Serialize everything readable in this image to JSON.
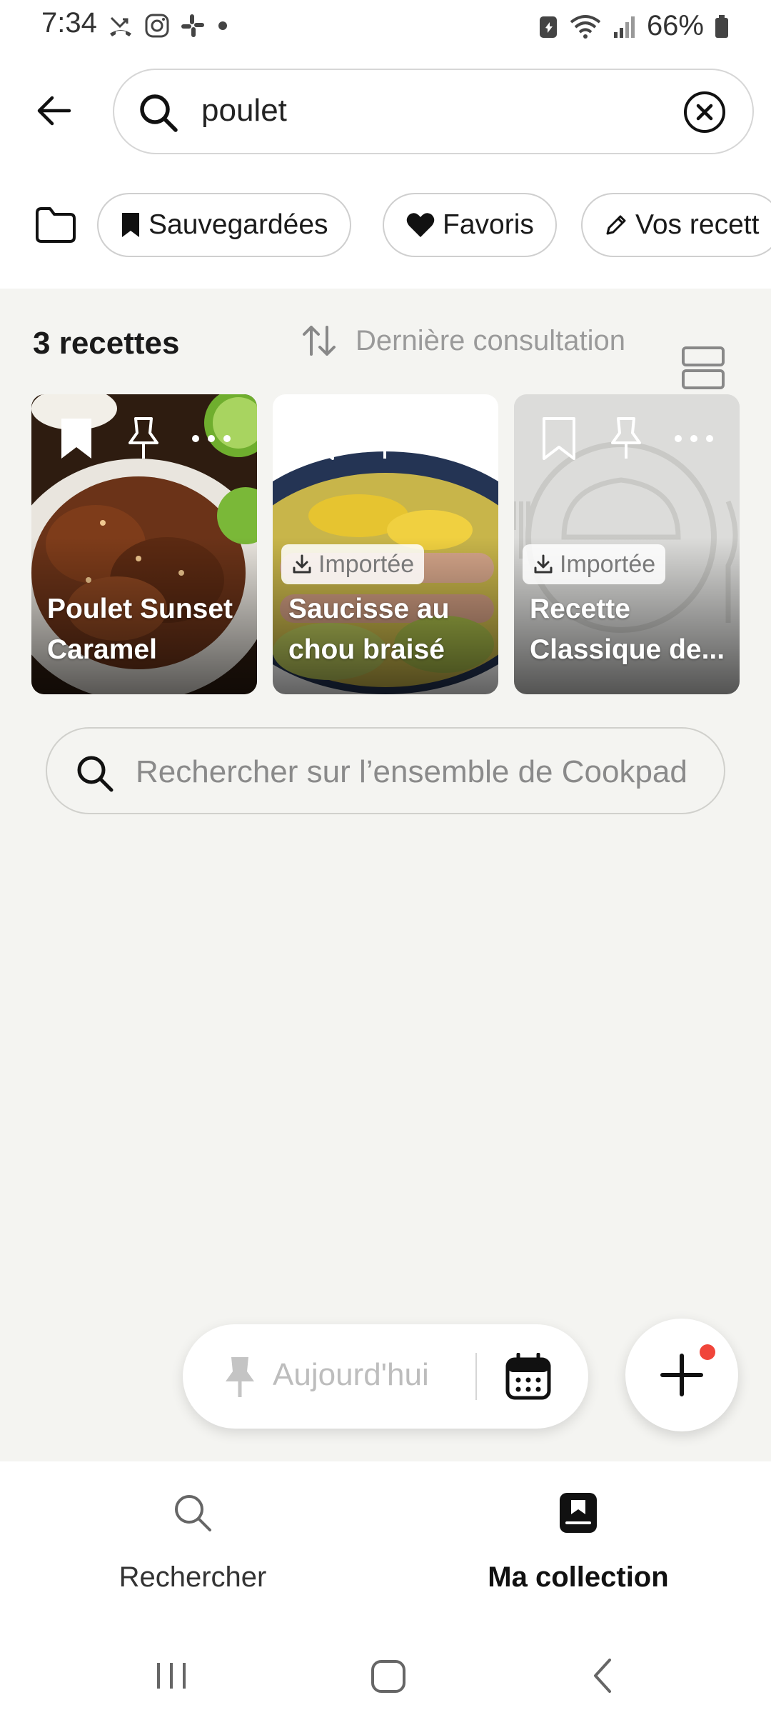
{
  "status_bar": {
    "time": "7:34",
    "battery": "66%"
  },
  "header": {
    "search_value": "poulet"
  },
  "filters": {
    "chips": [
      {
        "label": "Sauvegardées",
        "icon": "bookmark-icon"
      },
      {
        "label": "Favoris",
        "icon": "heart-icon"
      },
      {
        "label": "Vos recett",
        "icon": "pencil-icon"
      }
    ]
  },
  "results": {
    "count_label": "3 recettes",
    "sort_label": "Dernière consultation"
  },
  "cards": [
    {
      "title": "Poulet Sunset Caramel",
      "badge": ""
    },
    {
      "title": "Saucisse au chou braisé",
      "badge": "Importée"
    },
    {
      "title": "Recette Classique de...",
      "badge": "Importée"
    }
  ],
  "global_search": {
    "placeholder": "Rechercher sur l’ensemble de Cookpad"
  },
  "planner": {
    "today_label": "Aujourd'hui"
  },
  "bottom_nav": {
    "search_label": "Rechercher",
    "collection_label": "Ma collection"
  },
  "colors": {
    "accent_dot": "#f0453a",
    "background": "#f4f4f1"
  }
}
